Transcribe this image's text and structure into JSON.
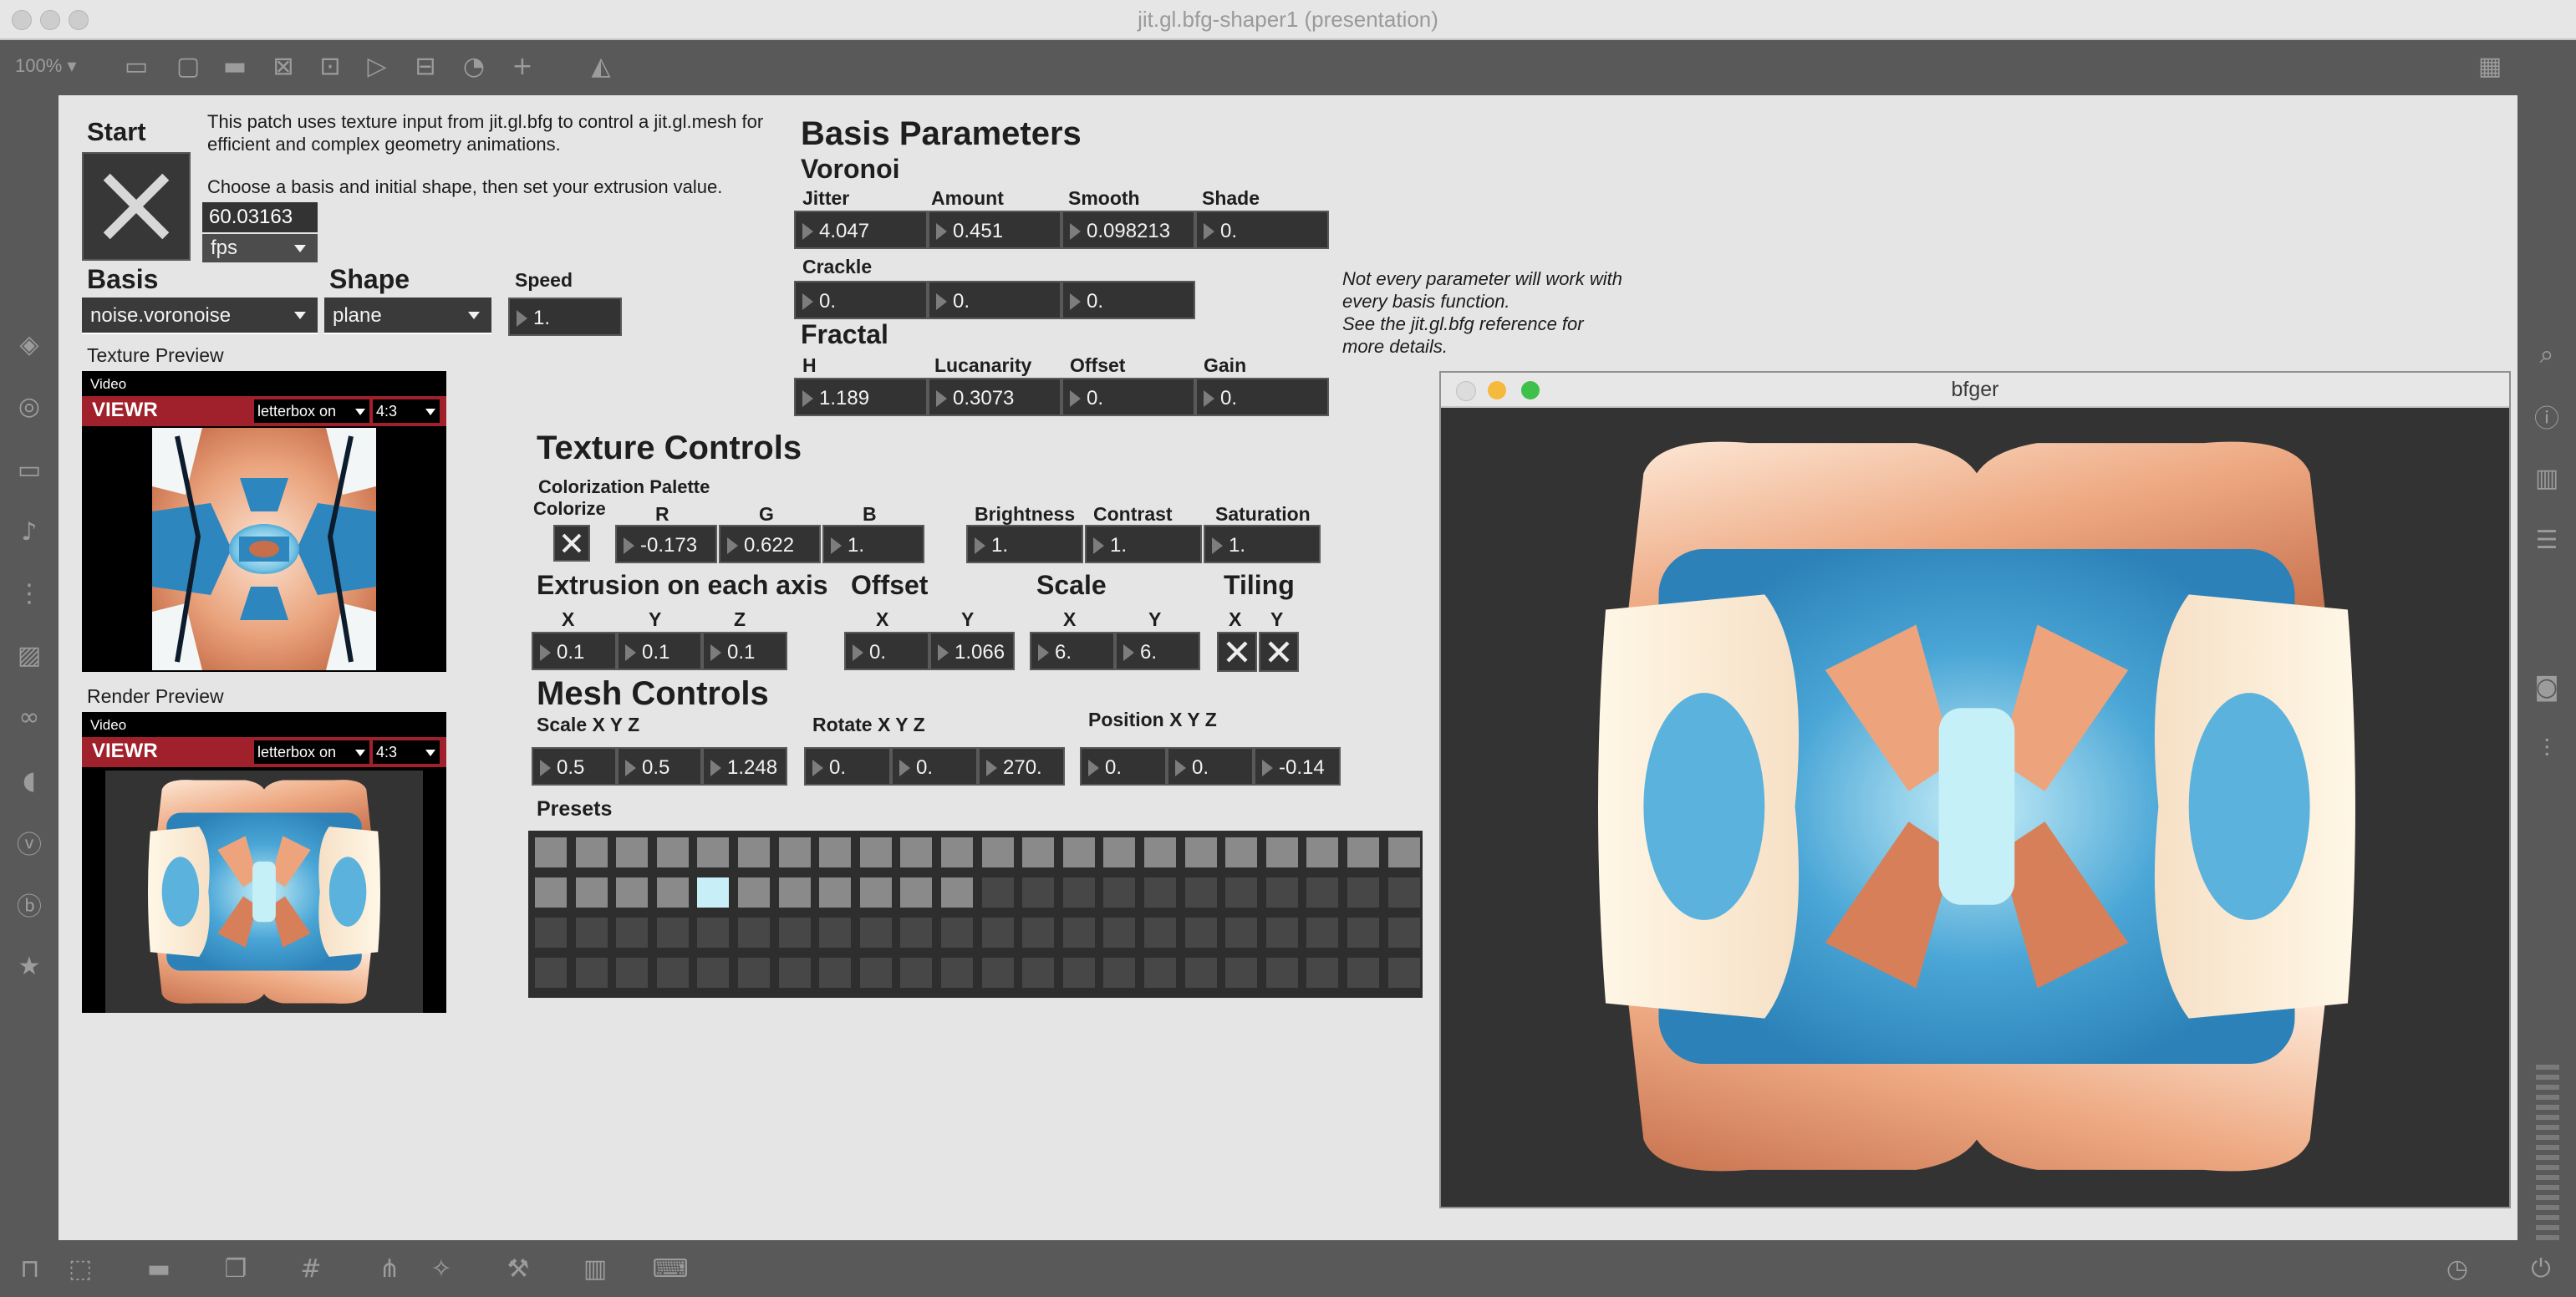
{
  "window": {
    "title": "jit.gl.bfg-shaper1 (presentation)",
    "zoom": "100% ▾"
  },
  "toolbar_icons": [
    "panel-icon",
    "m-icon",
    "comment-icon",
    "x-icon",
    "target-icon",
    "media-icon",
    "split-icon",
    "gauge-icon",
    "plus-icon",
    "paint-bucket-icon"
  ],
  "left_icons": [
    "cube-icon",
    "speaker-icon",
    "bus-icon",
    "note-icon",
    "play-list-icon",
    "image-icon",
    "link-icon",
    "plug-icon",
    "v-icon",
    "b-icon",
    "star-icon"
  ],
  "right_icons": [
    "search-icon",
    "info-icon",
    "book-icon",
    "list-icon",
    "camera-icon",
    "sliders-icon"
  ],
  "bottom_icons": [
    "lock-icon",
    "edit-icon",
    "comment-icon",
    "windows-icon",
    "grid-icon",
    "tree-icon",
    "wand-icon",
    "wrench-icon",
    "piano-icon",
    "keyboard-icon"
  ],
  "start": {
    "label": "Start",
    "fps_value": "60.03163",
    "fps_unit": "fps",
    "desc1": "This patch uses texture input from jit.gl.bfg to control a jit.gl.mesh for efficient and complex geometry animations.",
    "desc2": "Choose a basis and initial shape, then set your extrusion value."
  },
  "basis": {
    "label": "Basis",
    "value": "noise.voronoise"
  },
  "shape": {
    "label": "Shape",
    "value": "plane"
  },
  "speed": {
    "label": "Speed",
    "value": "1."
  },
  "texture_preview": {
    "label": "Texture Preview",
    "tag": "Video",
    "name": "VIEWR",
    "letterbox": "letterbox on",
    "aspect": "4:3"
  },
  "render_preview": {
    "label": "Render Preview",
    "tag": "Video",
    "name": "VIEWR",
    "letterbox": "letterbox on",
    "aspect": "4:3"
  },
  "basis_params": {
    "title": "Basis Parameters",
    "voronoi": "Voronoi",
    "jitter_label": "Jitter",
    "jitter": "4.047",
    "amount_label": "Amount",
    "amount": "0.451",
    "smooth_label": "Smooth",
    "smooth": "0.098213",
    "shade_label": "Shade",
    "shade": "0.",
    "crackle_label": "Crackle",
    "crackle": [
      "0.",
      "0.",
      "0."
    ],
    "fractal": "Fractal",
    "h_label": "H",
    "h": "1.189",
    "lacunarity_label": "Lucanarity",
    "lacunarity": "0.3073",
    "offset_label": "Offset",
    "offset": "0.",
    "gain_label": "Gain",
    "gain": "0."
  },
  "note": [
    "Not every parameter will work with",
    "every basis function.",
    "See the jit.gl.bfg reference for",
    "more details."
  ],
  "texture_controls": {
    "title": "Texture Controls",
    "palette_label": "Colorization Palette",
    "colorize_label": "Colorize",
    "r_label": "R",
    "r": "-0.173",
    "g_label": "G",
    "g": "0.622",
    "b_label": "B",
    "b": "1.",
    "brightness_label": "Brightness",
    "brightness": "1.",
    "contrast_label": "Contrast",
    "contrast": "1.",
    "saturation_label": "Saturation",
    "saturation": "1.",
    "extrusion_label": "Extrusion on each axis",
    "ext_x": "0.1",
    "ext_y": "0.1",
    "ext_z": "0.1",
    "offset_label": "Offset",
    "off_x": "0.",
    "off_y": "1.066",
    "scale_label": "Scale",
    "scale_x": "6.",
    "scale_y": "6.",
    "tiling_label": "Tiling",
    "x": "X",
    "y": "Y",
    "z": "Z"
  },
  "mesh_controls": {
    "title": "Mesh Controls",
    "scale_label": "Scale X Y Z",
    "scale": [
      "0.5",
      "0.5",
      "1.248"
    ],
    "rotate_label": "Rotate X Y Z",
    "rotate": [
      "0.",
      "0.",
      "270."
    ],
    "position_label": "Position X Y Z",
    "position": [
      "0.",
      "0.",
      "-0.14"
    ]
  },
  "presets": {
    "label": "Presets",
    "filled_count": 33,
    "selected_index": 26
  },
  "bfger": {
    "title": "bfger"
  },
  "colors": {
    "accent": "#a0202b",
    "number_box": "#333333",
    "canvas": "#e5e5e5",
    "chrome": "#595959"
  }
}
